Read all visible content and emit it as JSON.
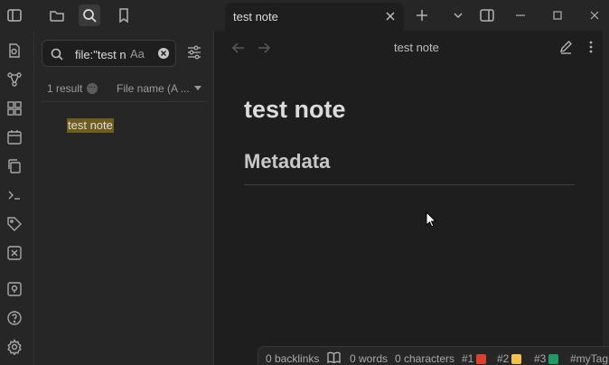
{
  "tab": {
    "title": "test note"
  },
  "search": {
    "query": "file:\"test n",
    "match_case_label": "Aa"
  },
  "results": {
    "count_label": "1 result",
    "sort_label": "File name (A ...",
    "items": [
      "test note"
    ]
  },
  "view": {
    "title": "test note"
  },
  "note": {
    "heading1": "test note",
    "heading2": "Metadata"
  },
  "status": {
    "backlinks": "0 backlinks",
    "words": "0 words",
    "characters": "0 characters",
    "tags": [
      {
        "label": "#1",
        "color": "#e0402f"
      },
      {
        "label": "#2",
        "color": "#f2c14e"
      },
      {
        "label": "#3",
        "color": "#1e9a64"
      },
      {
        "label": "#myTag"
      }
    ]
  },
  "colors": {
    "highlight": "#6f5d1e",
    "background": "#1e1e1e",
    "panel": "#262626"
  }
}
